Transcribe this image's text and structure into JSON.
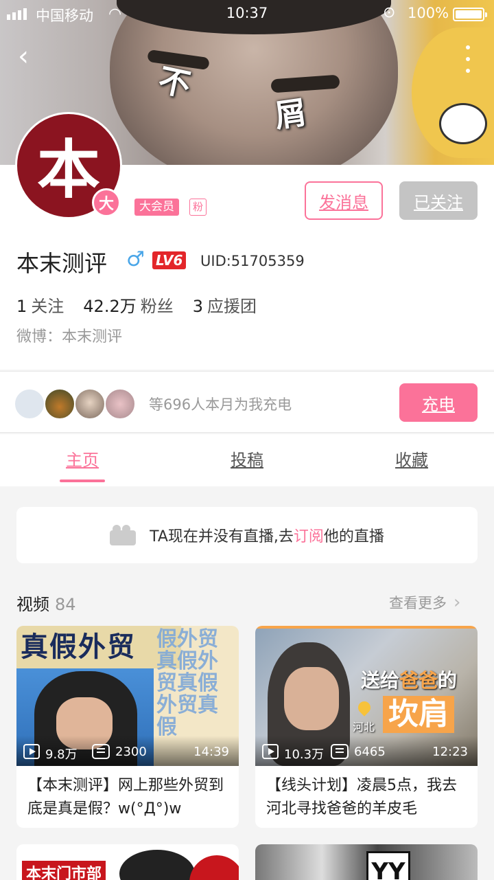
{
  "status_bar": {
    "carrier": "中国移动",
    "time": "10:37",
    "battery": "100%"
  },
  "banner": {
    "caption_1": "不",
    "caption_2": "屑"
  },
  "profile": {
    "avatar_text": "本",
    "badge_big": "大",
    "vip_label": "大会员",
    "fan_label": "粉",
    "message_button": "发消息",
    "follow_button": "已关注",
    "name": "本末测评",
    "gender_symbol": "♂",
    "level": "LV6",
    "uid": "UID:51705359",
    "following_count": "1",
    "following_label": "关注",
    "fans_count": "42.2万",
    "fans_label": "粉丝",
    "support_count": "3",
    "support_label": "应援团",
    "weibo": "微博：本末测评"
  },
  "charge": {
    "text": "等696人本月为我充电",
    "button": "充电"
  },
  "tabs": [
    {
      "label": "主页",
      "active": true
    },
    {
      "label": "投稿",
      "active": false
    },
    {
      "label": "收藏",
      "active": false
    }
  ],
  "live": {
    "prefix": "TA现在并没有直播,去",
    "link": "订阅",
    "suffix": "他的直播"
  },
  "videos": {
    "heading": "视频",
    "count": "84",
    "see_more": "查看更多",
    "items": [
      {
        "thumb_header": "真假外贸",
        "thumb_side": "假外贸真假外贸真假外贸真假",
        "views": "9.8万",
        "danmaku": "2300",
        "duration": "14:39",
        "title": "【本末测评】网上那些外贸到底是真是假？w(°Д°)w"
      },
      {
        "thumb_caption_pre": "送给",
        "thumb_caption_hl": "爸爸",
        "thumb_caption_post": "的",
        "thumb_caption_big": "坎肩",
        "thumb_location": "河北",
        "views": "10.3万",
        "danmaku": "6465",
        "duration": "12:23",
        "title": "【线头计划】凌晨5点，我去河北寻找爸爸的羊皮毛"
      }
    ],
    "partial": [
      {
        "label": "本末门市部"
      },
      {
        "label": "YY"
      }
    ]
  },
  "colors": {
    "accent": "#fb7299",
    "avatar_bg": "#8b1420",
    "level_bg": "#e3262a"
  }
}
